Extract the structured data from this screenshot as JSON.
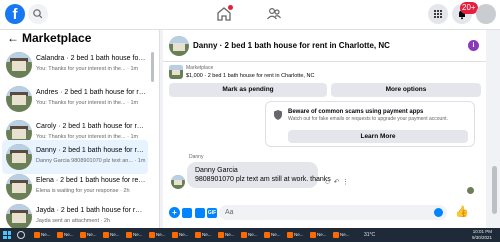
{
  "colors": {
    "brand": "#1877f2",
    "accent": "#0084ff",
    "badge": "#e41e3f",
    "info": "#8a3ab9"
  },
  "topnav": {
    "logo": "f",
    "icons": [
      "search-icon",
      "home-icon",
      "groups-icon",
      "menu-icon",
      "notifications-icon",
      "profile-avatar"
    ],
    "notification_count": "20+"
  },
  "sidebar": {
    "title": "Marketplace",
    "items": [
      {
        "name": "Calandra · 2 bed 1 bath house for ...",
        "subtitle": "You: Thanks for your interest in the... · 1m"
      },
      {
        "name": "Andres · 2 bed 1 bath house for re...",
        "subtitle": "You: Thanks for your interest in the... · 1m"
      },
      {
        "name": "Caroly · 2 bed 1 bath house for re...",
        "subtitle": "You: Thanks for your interest in the... · 1m"
      },
      {
        "name": "Danny · 2 bed 1 bath house for re...",
        "subtitle": "Danny Garcia 9808901070 plz text an... · 1m"
      },
      {
        "name": "Elena · 2 bed 1 bath house for ren...",
        "subtitle": "Elena is waiting for your response · 2h"
      },
      {
        "name": "Jayda · 2 bed 1 bath house for ren...",
        "subtitle": "Jayda sent an attachment · 2h"
      }
    ]
  },
  "conversation": {
    "title": "Danny · 2 bed 1 bath house for rent in Charlotte, NC",
    "listing_label": "Marketplace",
    "listing_detail": "$1,000 · 2 bed 1 bath house for rent in Charlotte, NC",
    "mark_pending": "Mark as pending",
    "more_options": "More options",
    "scam_title": "Beware of common scams using payment apps",
    "scam_subtitle": "Watch out for fake emails or requests to upgrade your payment account.",
    "learn_more": "Learn More",
    "sender": "Danny",
    "message_line1": "Danny Garcia",
    "message_line2": "9808901070 plz text am still at work. thanks",
    "composer_placeholder": "Aa"
  },
  "taskbar": {
    "apps": [
      "Ne...",
      "Ne...",
      "Ne...",
      "Ne...",
      "Ne...",
      "Ne...",
      "Ne...",
      "Ne...",
      "Ne...",
      "Ne...",
      "Ne...",
      "Ne...",
      "Ne...",
      "Ne..."
    ],
    "weather": "31°C",
    "time": "10:01 PM",
    "date": "9/30/2021"
  }
}
